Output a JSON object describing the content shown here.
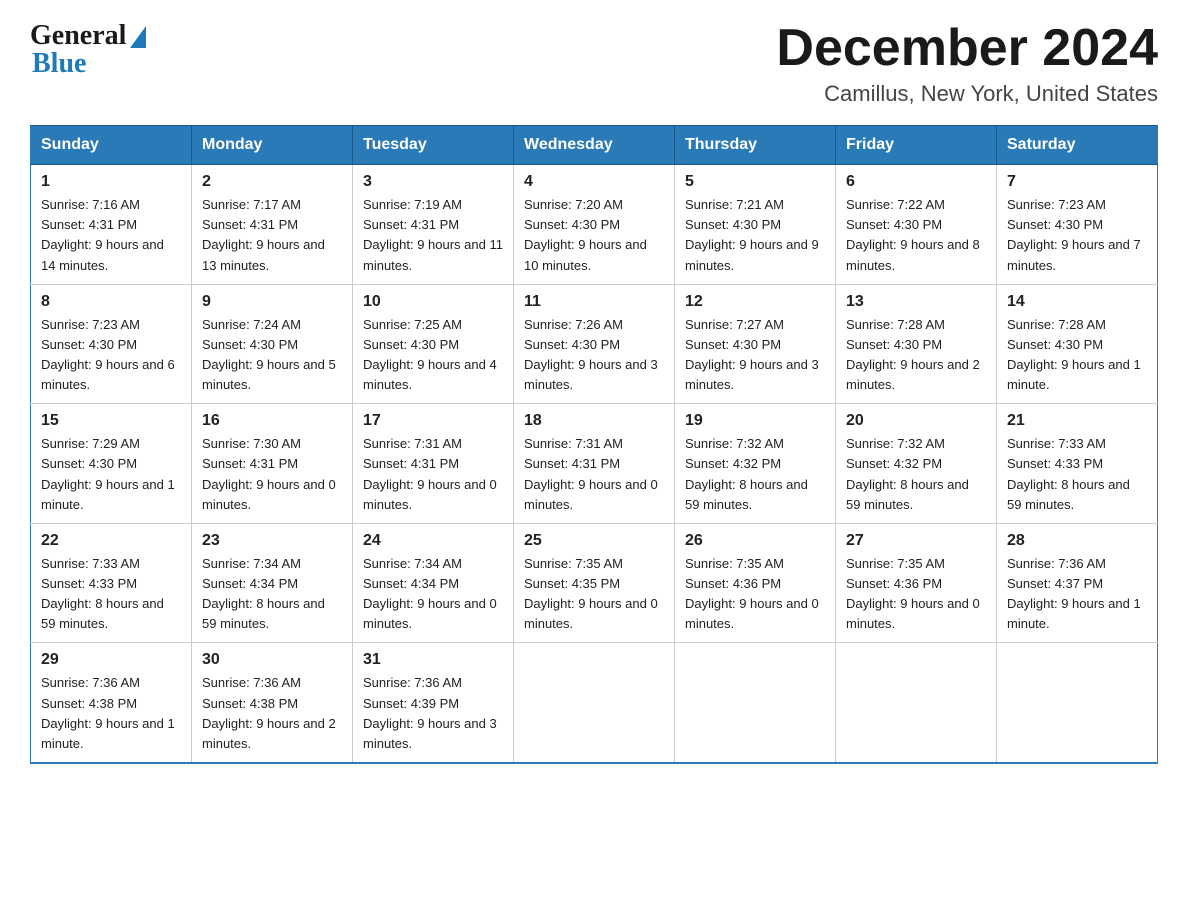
{
  "header": {
    "logo_general": "General",
    "logo_blue": "Blue",
    "month_title": "December 2024",
    "location": "Camillus, New York, United States"
  },
  "days_of_week": [
    "Sunday",
    "Monday",
    "Tuesday",
    "Wednesday",
    "Thursday",
    "Friday",
    "Saturday"
  ],
  "weeks": [
    [
      {
        "day": "1",
        "sunrise": "7:16 AM",
        "sunset": "4:31 PM",
        "daylight": "9 hours and 14 minutes."
      },
      {
        "day": "2",
        "sunrise": "7:17 AM",
        "sunset": "4:31 PM",
        "daylight": "9 hours and 13 minutes."
      },
      {
        "day": "3",
        "sunrise": "7:19 AM",
        "sunset": "4:31 PM",
        "daylight": "9 hours and 11 minutes."
      },
      {
        "day": "4",
        "sunrise": "7:20 AM",
        "sunset": "4:30 PM",
        "daylight": "9 hours and 10 minutes."
      },
      {
        "day": "5",
        "sunrise": "7:21 AM",
        "sunset": "4:30 PM",
        "daylight": "9 hours and 9 minutes."
      },
      {
        "day": "6",
        "sunrise": "7:22 AM",
        "sunset": "4:30 PM",
        "daylight": "9 hours and 8 minutes."
      },
      {
        "day": "7",
        "sunrise": "7:23 AM",
        "sunset": "4:30 PM",
        "daylight": "9 hours and 7 minutes."
      }
    ],
    [
      {
        "day": "8",
        "sunrise": "7:23 AM",
        "sunset": "4:30 PM",
        "daylight": "9 hours and 6 minutes."
      },
      {
        "day": "9",
        "sunrise": "7:24 AM",
        "sunset": "4:30 PM",
        "daylight": "9 hours and 5 minutes."
      },
      {
        "day": "10",
        "sunrise": "7:25 AM",
        "sunset": "4:30 PM",
        "daylight": "9 hours and 4 minutes."
      },
      {
        "day": "11",
        "sunrise": "7:26 AM",
        "sunset": "4:30 PM",
        "daylight": "9 hours and 3 minutes."
      },
      {
        "day": "12",
        "sunrise": "7:27 AM",
        "sunset": "4:30 PM",
        "daylight": "9 hours and 3 minutes."
      },
      {
        "day": "13",
        "sunrise": "7:28 AM",
        "sunset": "4:30 PM",
        "daylight": "9 hours and 2 minutes."
      },
      {
        "day": "14",
        "sunrise": "7:28 AM",
        "sunset": "4:30 PM",
        "daylight": "9 hours and 1 minute."
      }
    ],
    [
      {
        "day": "15",
        "sunrise": "7:29 AM",
        "sunset": "4:30 PM",
        "daylight": "9 hours and 1 minute."
      },
      {
        "day": "16",
        "sunrise": "7:30 AM",
        "sunset": "4:31 PM",
        "daylight": "9 hours and 0 minutes."
      },
      {
        "day": "17",
        "sunrise": "7:31 AM",
        "sunset": "4:31 PM",
        "daylight": "9 hours and 0 minutes."
      },
      {
        "day": "18",
        "sunrise": "7:31 AM",
        "sunset": "4:31 PM",
        "daylight": "9 hours and 0 minutes."
      },
      {
        "day": "19",
        "sunrise": "7:32 AM",
        "sunset": "4:32 PM",
        "daylight": "8 hours and 59 minutes."
      },
      {
        "day": "20",
        "sunrise": "7:32 AM",
        "sunset": "4:32 PM",
        "daylight": "8 hours and 59 minutes."
      },
      {
        "day": "21",
        "sunrise": "7:33 AM",
        "sunset": "4:33 PM",
        "daylight": "8 hours and 59 minutes."
      }
    ],
    [
      {
        "day": "22",
        "sunrise": "7:33 AM",
        "sunset": "4:33 PM",
        "daylight": "8 hours and 59 minutes."
      },
      {
        "day": "23",
        "sunrise": "7:34 AM",
        "sunset": "4:34 PM",
        "daylight": "8 hours and 59 minutes."
      },
      {
        "day": "24",
        "sunrise": "7:34 AM",
        "sunset": "4:34 PM",
        "daylight": "9 hours and 0 minutes."
      },
      {
        "day": "25",
        "sunrise": "7:35 AM",
        "sunset": "4:35 PM",
        "daylight": "9 hours and 0 minutes."
      },
      {
        "day": "26",
        "sunrise": "7:35 AM",
        "sunset": "4:36 PM",
        "daylight": "9 hours and 0 minutes."
      },
      {
        "day": "27",
        "sunrise": "7:35 AM",
        "sunset": "4:36 PM",
        "daylight": "9 hours and 0 minutes."
      },
      {
        "day": "28",
        "sunrise": "7:36 AM",
        "sunset": "4:37 PM",
        "daylight": "9 hours and 1 minute."
      }
    ],
    [
      {
        "day": "29",
        "sunrise": "7:36 AM",
        "sunset": "4:38 PM",
        "daylight": "9 hours and 1 minute."
      },
      {
        "day": "30",
        "sunrise": "7:36 AM",
        "sunset": "4:38 PM",
        "daylight": "9 hours and 2 minutes."
      },
      {
        "day": "31",
        "sunrise": "7:36 AM",
        "sunset": "4:39 PM",
        "daylight": "9 hours and 3 minutes."
      },
      null,
      null,
      null,
      null
    ]
  ],
  "labels": {
    "sunrise": "Sunrise: ",
    "sunset": "Sunset: ",
    "daylight": "Daylight: "
  }
}
